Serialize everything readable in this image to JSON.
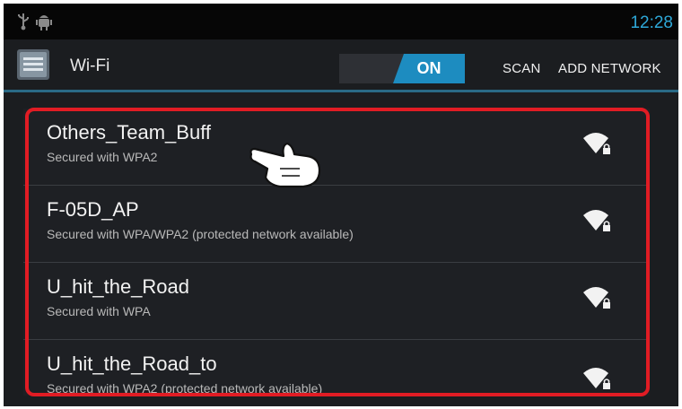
{
  "status_bar": {
    "time": "12:28",
    "icons": [
      "usb-icon",
      "android-debug-icon"
    ]
  },
  "action_bar": {
    "title": "Wi-Fi",
    "toggle_state": "ON",
    "scan_label": "SCAN",
    "add_network_label": "ADD NETWORK",
    "icons": [
      "wifi-settings-app-icon"
    ]
  },
  "networks": [
    {
      "ssid": "Others_Team_Buff",
      "security": "Secured with WPA2",
      "icon": "wifi-locked-icon"
    },
    {
      "ssid": "F-05D_AP",
      "security": "Secured with WPA/WPA2 (protected network available)",
      "icon": "wifi-locked-icon"
    },
    {
      "ssid": "U_hit_the_Road",
      "security": "Secured with WPA",
      "icon": "wifi-locked-icon"
    },
    {
      "ssid": "U_hit_the_Road_to",
      "security": "Secured with WPA2 (protected network available)",
      "icon": "wifi-locked-icon"
    }
  ],
  "overlay": {
    "highlight_color": "#e11c24",
    "pointer": "pointing-hand-icon"
  },
  "colors": {
    "accent": "#1d8cc0",
    "clock": "#2ea8d8",
    "background": "#1b1d20"
  }
}
